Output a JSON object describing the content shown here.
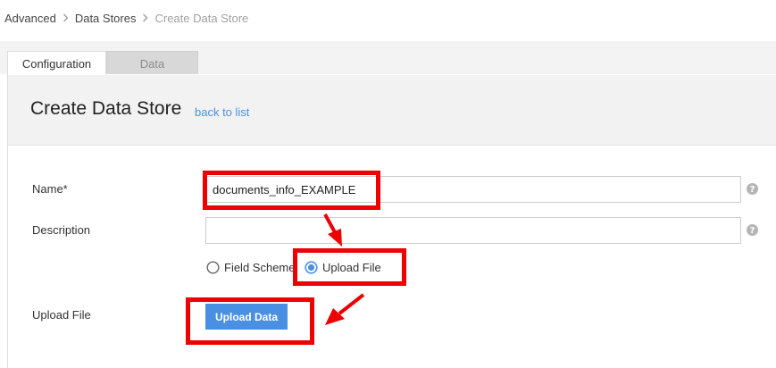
{
  "breadcrumb": {
    "items": [
      "Advanced",
      "Data Stores",
      "Create Data Store"
    ]
  },
  "tabs": [
    {
      "label": "Configuration",
      "active": true
    },
    {
      "label": "Data",
      "active": false
    }
  ],
  "header": {
    "title": "Create Data Store",
    "back_link": "back to list"
  },
  "form": {
    "name_label": "Name*",
    "name_value": "documents_info_EXAMPLE",
    "description_label": "Description",
    "description_value": "",
    "source_options": [
      {
        "label": "Field Scheme",
        "selected": false
      },
      {
        "label": "Upload File",
        "selected": true
      }
    ],
    "upload_label": "Upload File",
    "upload_button": "Upload Data"
  },
  "colors": {
    "accent": "#4a90e2",
    "annotation": "#ee0000"
  }
}
